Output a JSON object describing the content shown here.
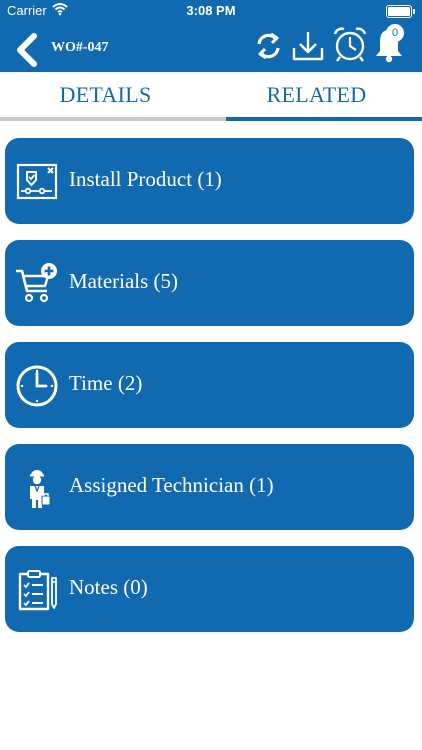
{
  "status_bar": {
    "carrier": "Carrier",
    "time": "3:08 PM"
  },
  "header": {
    "title": "WO#-047",
    "notification_count": "0",
    "icons": [
      "back-chevron-icon",
      "refresh-icon",
      "download-icon",
      "alarm-clock-icon",
      "bell-icon"
    ]
  },
  "tabs": [
    {
      "label": "DETAILS",
      "active": false
    },
    {
      "label": "RELATED",
      "active": true
    }
  ],
  "cards": [
    {
      "label": "Install Product (1)",
      "icon": "install-product-icon"
    },
    {
      "label": "Materials (5)",
      "icon": "cart-add-icon"
    },
    {
      "label": "Time (2)",
      "icon": "clock-icon"
    },
    {
      "label": "Assigned Technician (1)",
      "icon": "technician-icon"
    },
    {
      "label": "Notes (0)",
      "icon": "clipboard-notes-icon"
    }
  ],
  "colors": {
    "primary": "#1169b0",
    "inactive_underline": "#c9c9c9",
    "background": "#ffffff"
  }
}
